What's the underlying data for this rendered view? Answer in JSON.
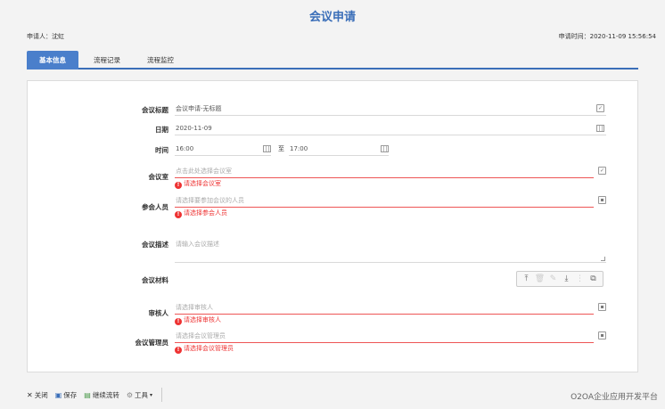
{
  "page_title": "会议申请",
  "applicant": "申请人：沈虹",
  "apply_time": "申请时间：2020-11-09 15:56:54",
  "tabs": [
    {
      "label": "基本信息",
      "active": true
    },
    {
      "label": "流程记录",
      "active": false
    },
    {
      "label": "流程监控",
      "active": false
    }
  ],
  "form": {
    "subject_label": "会议标题",
    "subject_value": "会议申请-无标题",
    "date_label": "日期",
    "date_value": "2020-11-09",
    "time_label": "时间",
    "start_time": "16:00",
    "to_label": "至",
    "end_time": "17:00",
    "room_label": "会议室",
    "room_placeholder": "点击此处选择会议室",
    "room_error": "请选择会议室",
    "attendees_label": "参会人员",
    "attendees_placeholder": "请选择要参加会议的人员",
    "attendees_error": "请选择参会人员",
    "desc_label": "会议描述",
    "desc_placeholder": "请输入会议描述",
    "materials_label": "会议材料",
    "auditor_label": "审核人",
    "auditor_placeholder": "请选择审核人",
    "auditor_error": "请选择审核人",
    "manager_label": "会议管理员",
    "manager_placeholder": "请选择会议管理员",
    "manager_error": "请选择会议管理员"
  },
  "error_glyph": "!",
  "toolbar": {
    "close_label": "关闭",
    "save_label": "保存",
    "continue_label": "继续流转",
    "tools_label": "工具"
  },
  "watermark": "O2OA企业应用开发平台",
  "colors": {
    "accent": "#3a6eb8",
    "error": "#e33333"
  }
}
